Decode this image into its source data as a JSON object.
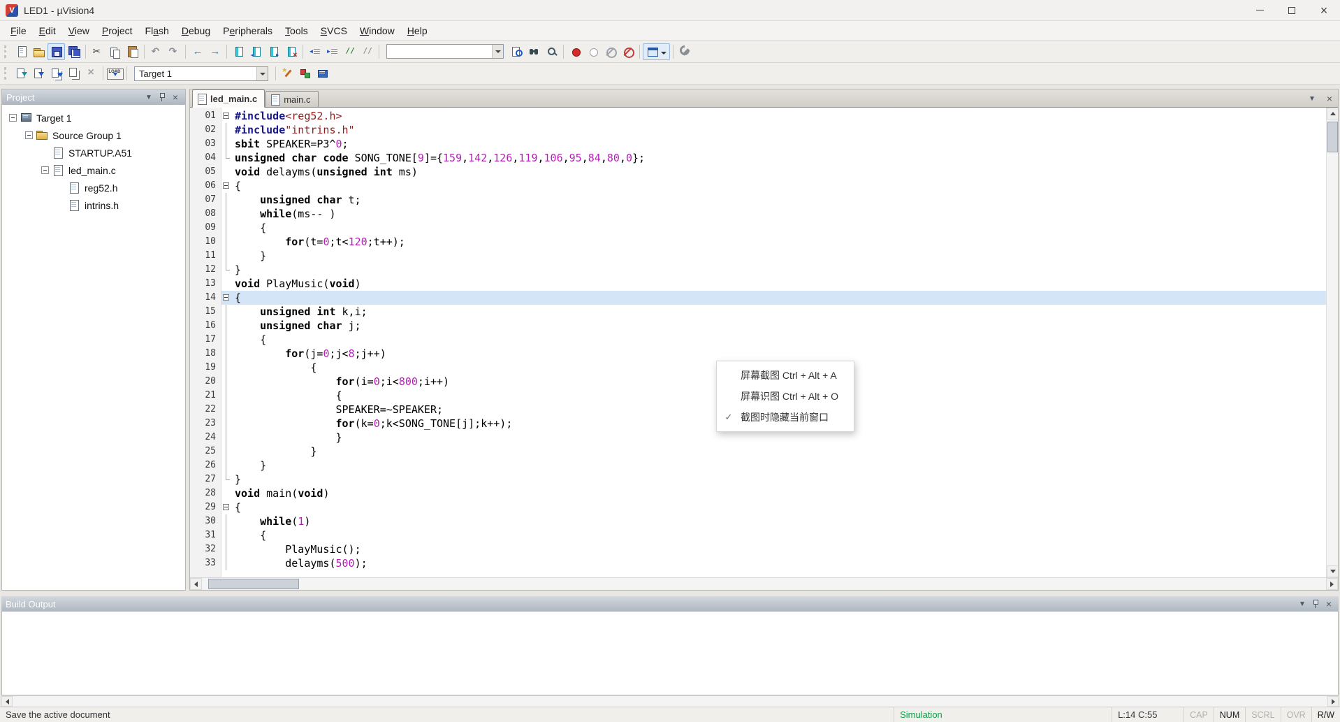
{
  "window": {
    "title": "LED1 - µVision4"
  },
  "colors": {
    "string-color": "#8b1f1f",
    "number-color": "#b61fb6",
    "preproc-color": "#17178f",
    "line-highlight": "#d5e5f8",
    "mode-color": "#0ca24a"
  },
  "menu_bar": {
    "items": [
      {
        "label": "File",
        "accel": 0
      },
      {
        "label": "Edit",
        "accel": 0
      },
      {
        "label": "View",
        "accel": 0
      },
      {
        "label": "Project",
        "accel": 0
      },
      {
        "label": "Flash",
        "accel": 2
      },
      {
        "label": "Debug",
        "accel": 0
      },
      {
        "label": "Peripherals",
        "accel": 1
      },
      {
        "label": "Tools",
        "accel": 0
      },
      {
        "label": "SVCS",
        "accel": 0
      },
      {
        "label": "Window",
        "accel": 0
      },
      {
        "label": "Help",
        "accel": 0
      }
    ]
  },
  "toolbar_main": {
    "search_value": "",
    "buttons": [
      "new-file",
      "open-folder",
      "save",
      "save-all",
      "sep",
      "cut",
      "copy",
      "paste",
      "sep",
      "undo",
      "redo",
      "sep",
      "nav-back",
      "nav-forward",
      "sep",
      "bookmark-toggle",
      "bookmark-prev",
      "bookmark-next",
      "bookmark-clear",
      "sep",
      "outdent",
      "indent",
      "comment",
      "uncomment",
      "sep",
      "search-box",
      "find-in-files",
      "find",
      "incremental-find",
      "sep",
      "bp-toggle",
      "bp-enable",
      "bp-disable-all",
      "bp-kill-all",
      "sep",
      "debug-views",
      "sep",
      "configure"
    ]
  },
  "toolbar_build": {
    "target_selector": "Target 1",
    "buttons": [
      "translate",
      "build",
      "rebuild",
      "batch-build",
      "stop-build",
      "sep",
      "download",
      "sep",
      "target-select",
      "sep",
      "options-target",
      "manage-components",
      "books"
    ]
  },
  "project_panel": {
    "title": "Project",
    "tree": [
      {
        "label": "Target 1",
        "level": 0,
        "expander": true,
        "icon": "target"
      },
      {
        "label": "Source Group 1",
        "level": 1,
        "expander": true,
        "icon": "folder"
      },
      {
        "label": "STARTUP.A51",
        "level": 2,
        "expander": false,
        "icon": "file"
      },
      {
        "label": "led_main.c",
        "level": 2,
        "expander": true,
        "icon": "file"
      },
      {
        "label": "reg52.h",
        "level": 3,
        "expander": false,
        "icon": "file"
      },
      {
        "label": "intrins.h",
        "level": 3,
        "expander": false,
        "icon": "file"
      }
    ]
  },
  "editor": {
    "tabs": [
      {
        "label": "led_main.c",
        "active": true
      },
      {
        "label": "main.c",
        "active": false
      }
    ],
    "highlight_line": 14,
    "lines": [
      {
        "n": "01",
        "fold": "box",
        "code": [
          [
            "pp",
            "#include"
          ],
          [
            "str",
            "<reg52.h>"
          ]
        ]
      },
      {
        "n": "02",
        "fold": "v",
        "code": [
          [
            "pp",
            "#include"
          ],
          [
            "str",
            "\"intrins.h\""
          ]
        ]
      },
      {
        "n": "03",
        "fold": "v",
        "code": [
          [
            "kw",
            "sbit"
          ],
          [
            "pl",
            " SPEAKER=P3^"
          ],
          [
            "num",
            "0"
          ],
          [
            "pl",
            ";"
          ]
        ]
      },
      {
        "n": "04",
        "fold": "end",
        "code": [
          [
            "kw",
            "unsigned"
          ],
          [
            "pl",
            " "
          ],
          [
            "kw",
            "char"
          ],
          [
            "pl",
            " "
          ],
          [
            "kw",
            "code"
          ],
          [
            "pl",
            " SONG_TONE["
          ],
          [
            "num",
            "9"
          ],
          [
            "pl",
            "]={"
          ],
          [
            "num",
            "159"
          ],
          [
            "pl",
            ","
          ],
          [
            "num",
            "142"
          ],
          [
            "pl",
            ","
          ],
          [
            "num",
            "126"
          ],
          [
            "pl",
            ","
          ],
          [
            "num",
            "119"
          ],
          [
            "pl",
            ","
          ],
          [
            "num",
            "106"
          ],
          [
            "pl",
            ","
          ],
          [
            "num",
            "95"
          ],
          [
            "pl",
            ","
          ],
          [
            "num",
            "84"
          ],
          [
            "pl",
            ","
          ],
          [
            "num",
            "80"
          ],
          [
            "pl",
            ","
          ],
          [
            "num",
            "0"
          ],
          [
            "pl",
            "};"
          ]
        ]
      },
      {
        "n": "05",
        "fold": "",
        "code": [
          [
            "kw",
            "void"
          ],
          [
            "pl",
            " delayms("
          ],
          [
            "kw",
            "unsigned"
          ],
          [
            "pl",
            " "
          ],
          [
            "kw",
            "int"
          ],
          [
            "pl",
            " ms)"
          ]
        ]
      },
      {
        "n": "06",
        "fold": "box",
        "code": [
          [
            "pl",
            "{"
          ]
        ]
      },
      {
        "n": "07",
        "fold": "v",
        "code": [
          [
            "pl",
            "    "
          ],
          [
            "kw",
            "unsigned"
          ],
          [
            "pl",
            " "
          ],
          [
            "kw",
            "char"
          ],
          [
            "pl",
            " t;"
          ]
        ]
      },
      {
        "n": "08",
        "fold": "v",
        "code": [
          [
            "pl",
            "    "
          ],
          [
            "kw",
            "while"
          ],
          [
            "pl",
            "(ms-- )"
          ]
        ]
      },
      {
        "n": "09",
        "fold": "v",
        "code": [
          [
            "pl",
            "    {"
          ]
        ]
      },
      {
        "n": "10",
        "fold": "v",
        "code": [
          [
            "pl",
            "        "
          ],
          [
            "kw",
            "for"
          ],
          [
            "pl",
            "(t="
          ],
          [
            "num",
            "0"
          ],
          [
            "pl",
            ";t<"
          ],
          [
            "num",
            "120"
          ],
          [
            "pl",
            ";t++);"
          ]
        ]
      },
      {
        "n": "11",
        "fold": "v",
        "code": [
          [
            "pl",
            "    }"
          ]
        ]
      },
      {
        "n": "12",
        "fold": "end",
        "code": [
          [
            "pl",
            "}"
          ]
        ]
      },
      {
        "n": "13",
        "fold": "",
        "code": [
          [
            "kw",
            "void"
          ],
          [
            "pl",
            " PlayMusic("
          ],
          [
            "kw",
            "void"
          ],
          [
            "pl",
            ")"
          ]
        ]
      },
      {
        "n": "14",
        "fold": "box",
        "code": [
          [
            "pl",
            "{"
          ]
        ]
      },
      {
        "n": "15",
        "fold": "v",
        "code": [
          [
            "pl",
            "    "
          ],
          [
            "kw",
            "unsigned"
          ],
          [
            "pl",
            " "
          ],
          [
            "kw",
            "int"
          ],
          [
            "pl",
            " k,i;"
          ]
        ]
      },
      {
        "n": "16",
        "fold": "v",
        "code": [
          [
            "pl",
            "    "
          ],
          [
            "kw",
            "unsigned"
          ],
          [
            "pl",
            " "
          ],
          [
            "kw",
            "char"
          ],
          [
            "pl",
            " j;"
          ]
        ]
      },
      {
        "n": "17",
        "fold": "v",
        "code": [
          [
            "pl",
            "    {"
          ]
        ]
      },
      {
        "n": "18",
        "fold": "v",
        "code": [
          [
            "pl",
            "        "
          ],
          [
            "kw",
            "for"
          ],
          [
            "pl",
            "(j="
          ],
          [
            "num",
            "0"
          ],
          [
            "pl",
            ";j<"
          ],
          [
            "num",
            "8"
          ],
          [
            "pl",
            ";j++)"
          ]
        ]
      },
      {
        "n": "19",
        "fold": "v",
        "code": [
          [
            "pl",
            "            {"
          ]
        ]
      },
      {
        "n": "20",
        "fold": "v",
        "code": [
          [
            "pl",
            "                "
          ],
          [
            "kw",
            "for"
          ],
          [
            "pl",
            "(i="
          ],
          [
            "num",
            "0"
          ],
          [
            "pl",
            ";i<"
          ],
          [
            "num",
            "800"
          ],
          [
            "pl",
            ";i++)"
          ]
        ]
      },
      {
        "n": "21",
        "fold": "v",
        "code": [
          [
            "pl",
            "                {"
          ]
        ]
      },
      {
        "n": "22",
        "fold": "v",
        "code": [
          [
            "pl",
            "                SPEAKER=~SPEAKER;"
          ]
        ]
      },
      {
        "n": "23",
        "fold": "v",
        "code": [
          [
            "pl",
            "                "
          ],
          [
            "kw",
            "for"
          ],
          [
            "pl",
            "(k="
          ],
          [
            "num",
            "0"
          ],
          [
            "pl",
            ";k<SONG_TONE[j];k++);"
          ]
        ]
      },
      {
        "n": "24",
        "fold": "v",
        "code": [
          [
            "pl",
            "                }"
          ]
        ]
      },
      {
        "n": "25",
        "fold": "v",
        "code": [
          [
            "pl",
            "            }"
          ]
        ]
      },
      {
        "n": "26",
        "fold": "v",
        "code": [
          [
            "pl",
            "    }"
          ]
        ]
      },
      {
        "n": "27",
        "fold": "end",
        "code": [
          [
            "pl",
            "}"
          ]
        ]
      },
      {
        "n": "28",
        "fold": "",
        "code": [
          [
            "kw",
            "void"
          ],
          [
            "pl",
            " main("
          ],
          [
            "kw",
            "void"
          ],
          [
            "pl",
            ")"
          ]
        ]
      },
      {
        "n": "29",
        "fold": "box",
        "code": [
          [
            "pl",
            "{"
          ]
        ]
      },
      {
        "n": "30",
        "fold": "v",
        "code": [
          [
            "pl",
            "    "
          ],
          [
            "kw",
            "while"
          ],
          [
            "pl",
            "("
          ],
          [
            "num",
            "1"
          ],
          [
            "pl",
            ")"
          ]
        ]
      },
      {
        "n": "31",
        "fold": "v",
        "code": [
          [
            "pl",
            "    {"
          ]
        ]
      },
      {
        "n": "32",
        "fold": "v",
        "code": [
          [
            "pl",
            "        PlayMusic();"
          ]
        ]
      },
      {
        "n": "33",
        "fold": "v",
        "code": [
          [
            "pl",
            "        delayms("
          ],
          [
            "num",
            "500"
          ],
          [
            "pl",
            ");"
          ]
        ]
      }
    ]
  },
  "overlay_menu": {
    "items": [
      {
        "label": "屏幕截图 Ctrl + Alt + A",
        "checked": false
      },
      {
        "label": "屏幕识图 Ctrl + Alt + O",
        "checked": false
      },
      {
        "label": "截图时隐藏当前窗口",
        "checked": true
      }
    ]
  },
  "build_output": {
    "title": "Build Output",
    "content": ""
  },
  "status_bar": {
    "message": "Save the active document",
    "mode": "Simulation",
    "cursor": "L:14 C:55",
    "indicators": [
      {
        "label": "CAP",
        "active": false
      },
      {
        "label": "NUM",
        "active": true
      },
      {
        "label": "SCRL",
        "active": false
      },
      {
        "label": "OVR",
        "active": false
      },
      {
        "label": "R/W",
        "active": true
      }
    ]
  }
}
